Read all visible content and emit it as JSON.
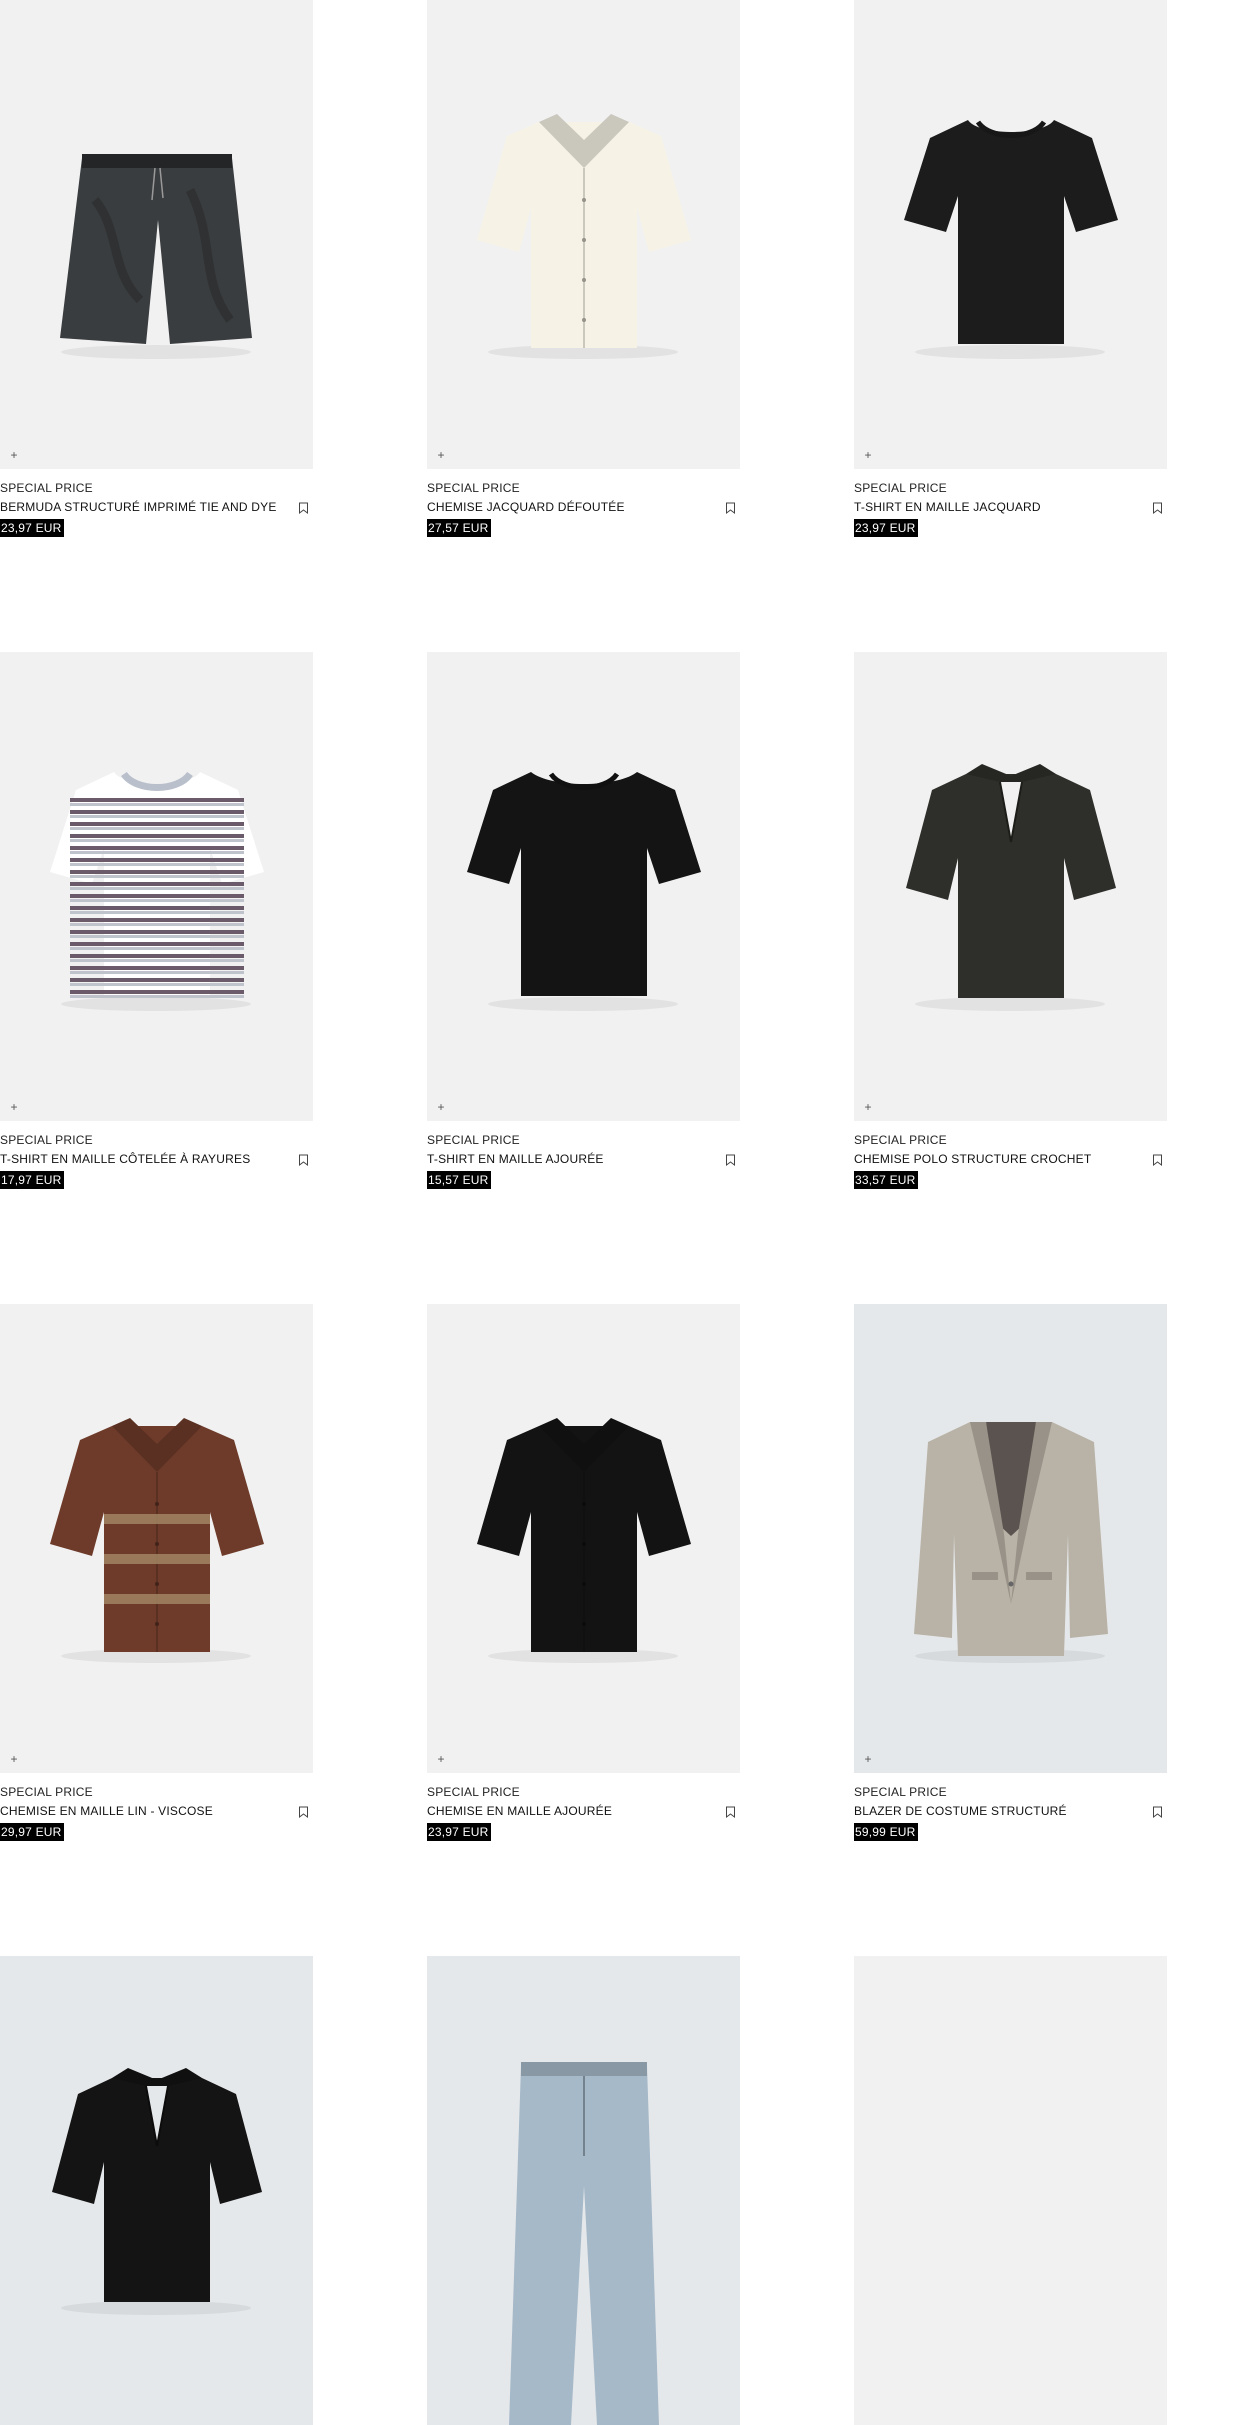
{
  "products": [
    {
      "tag": "SPECIAL PRICE",
      "name": "BERMUDA STRUCTURÉ IMPRIMÉ TIE AND DYE",
      "price": "23,97 EUR",
      "garment": "shorts",
      "color": "#3a3d3f",
      "bg": "#f1f1f1"
    },
    {
      "tag": "SPECIAL PRICE",
      "name": "CHEMISE JACQUARD DÉFOUTÉE",
      "price": "27,57 EUR",
      "garment": "shirt",
      "color": "#f6f3e6",
      "bg": "#f1f1f1"
    },
    {
      "tag": "SPECIAL PRICE",
      "name": "T-SHIRT EN MAILLE JACQUARD",
      "price": "23,97 EUR",
      "garment": "tshirt",
      "color": "#1c1c1c",
      "bg": "#f1f1f1"
    },
    {
      "tag": "SPECIAL PRICE",
      "name": "T-SHIRT EN MAILLE CÔTELÉE À RAYURES",
      "price": "17,97 EUR",
      "garment": "striped",
      "color": "#ffffff",
      "bg": "#f1f1f1"
    },
    {
      "tag": "SPECIAL PRICE",
      "name": "T-SHIRT EN MAILLE AJOURÉE",
      "price": "15,57 EUR",
      "garment": "boxytee",
      "color": "#141414",
      "bg": "#f1f1f1"
    },
    {
      "tag": "SPECIAL PRICE",
      "name": "CHEMISE POLO STRUCTURE CROCHET",
      "price": "33,57 EUR",
      "garment": "polo",
      "color": "#2e2f2a",
      "bg": "#f1f1f1"
    },
    {
      "tag": "SPECIAL PRICE",
      "name": "CHEMISE EN MAILLE LIN - VISCOSE",
      "price": "29,97 EUR",
      "garment": "brownshirt",
      "color": "#6e3b2a",
      "bg": "#f1f1f1"
    },
    {
      "tag": "SPECIAL PRICE",
      "name": "CHEMISE EN MAILLE AJOURÉE",
      "price": "23,97 EUR",
      "garment": "shirt",
      "color": "#131313",
      "bg": "#f1f1f1"
    },
    {
      "tag": "SPECIAL PRICE",
      "name": "BLAZER DE COSTUME STRUCTURÉ",
      "price": "59,99 EUR",
      "garment": "blazer",
      "color": "#b9b2a6",
      "bg": "#e5e8ea"
    },
    {
      "tag": "",
      "name": "",
      "price": "",
      "garment": "polo",
      "color": "#141414",
      "bg": "#e5e8ea"
    },
    {
      "tag": "",
      "name": "",
      "price": "",
      "garment": "trousers",
      "color": "#a6b9c9",
      "bg": "#e5e8ea"
    },
    {
      "tag": "",
      "name": "",
      "price": "",
      "garment": "none",
      "color": "#f1f1f1",
      "bg": "#f1f1f1"
    }
  ]
}
